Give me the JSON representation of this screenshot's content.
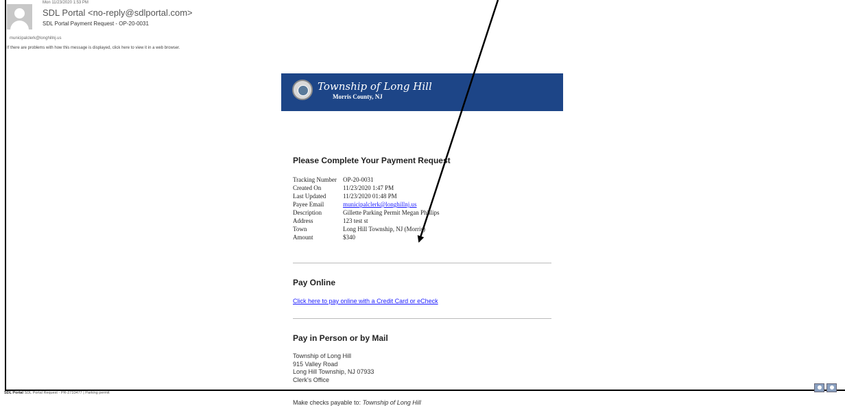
{
  "header": {
    "date": "Mon 11/23/2020 1:53 PM",
    "from": "SDL Portal <no-reply@sdlportal.com>",
    "subject": "SDL Portal Payment Request - OP-20-0031",
    "to": "municipalclerk@longhillnj.us",
    "info_bar": "If there are problems with how this message is displayed, click here to view it in a web browser."
  },
  "banner": {
    "title": "Township of Long Hill",
    "subtitle": "Morris County, NJ",
    "bg_color": "#1d4587"
  },
  "request": {
    "heading": "Please Complete Your Payment Request",
    "details": [
      {
        "label": "Tracking Number",
        "value": "OP-20-0031"
      },
      {
        "label": "Created On",
        "value": "11/23/2020 1:47 PM"
      },
      {
        "label": "Last Updated",
        "value": "11/23/2020 01:48 PM"
      },
      {
        "label": "Payee Email",
        "value": "municipalclerk@longhillnj.us"
      },
      {
        "label": "Description",
        "value": "Gillette Parking Permit Megan Phillips"
      },
      {
        "label": "Address",
        "value": "123 test st"
      },
      {
        "label": "Town",
        "value": "Long Hill Township, NJ (Morris)"
      },
      {
        "label": "Amount",
        "value": "$340"
      }
    ]
  },
  "pay_online": {
    "heading": "Pay Online",
    "link_text": "Click here to pay online with a Credit Card or eCheck"
  },
  "pay_person": {
    "heading": "Pay in Person or by Mail",
    "address_lines": [
      "Township of Long Hill",
      "915 Valley Road",
      "Long Hill Township, NJ 07933",
      "Clerk's Office"
    ],
    "checks_prefix": "Make checks payable to: ",
    "checks_payee": "Township of Long Hill"
  },
  "footer": {
    "sender": "SDL Portal",
    "text": "SDL Portal Request - PR-2733477 | Parking permit"
  },
  "colors": {
    "link": "#1a1aff",
    "arrow": "#000000"
  }
}
